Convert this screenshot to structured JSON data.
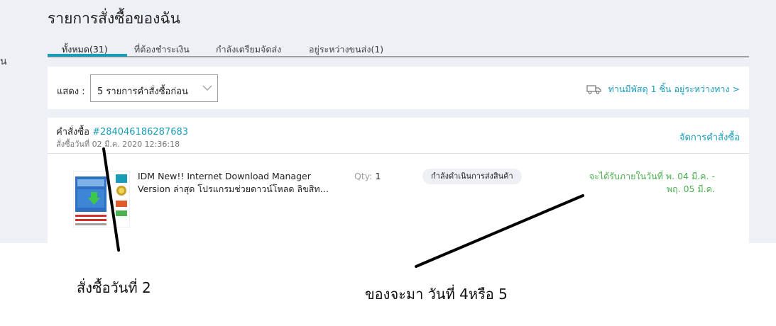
{
  "page": {
    "title": "รายการสั่งซื้อของฉัน",
    "sidebar_cut_text": "น"
  },
  "tabs": [
    {
      "label": "ทั้งหมด(31)",
      "active": true
    },
    {
      "label": "ที่ต้องชำระเงิน",
      "active": false
    },
    {
      "label": "กำลังเตรียมจัดส่ง",
      "active": false
    },
    {
      "label": "อยู่ระหว่างขนส่ง(1)",
      "active": false
    }
  ],
  "filter": {
    "label": "แสดง :",
    "selected": "5 รายการคำสั่งซื้อก่อน",
    "parcel_icon": "truck-icon",
    "parcel_text": "ท่านมีพัสดุ 1 ชิ้น อยู่ระหว่างทาง >"
  },
  "order": {
    "number_label": "คำสั่งซื้อ",
    "number": "#284046186287683",
    "date": "สั่งซื้อวันที่ 02 มี.ค. 2020 12:36:18",
    "manage_label": "จัดการคำสั่งซื้อ",
    "item": {
      "name_line1": "IDM New!! Internet Download Manager",
      "name_line2": "Version ล่าสุด โปรแกรมช่วยดาวน์โหลด ลิขสิท…",
      "qty_label": "Qty:",
      "qty_value": "1",
      "status": "กำลังดำเนินการส่งสินค้า",
      "delivery_line1": "จะได้รับภายในวันที่ พ. 04 มี.ค. -",
      "delivery_line2": "พฤ. 05 มี.ค."
    }
  },
  "annotations": {
    "order_date_note": "สั่งซื้อวันที่ 2",
    "delivery_note": "ของจะมา วันที่ 4หรือ 5"
  },
  "colors": {
    "accent": "#1a9cb7",
    "delivery_green": "#4caf50",
    "page_bg": "#eff0f5"
  }
}
